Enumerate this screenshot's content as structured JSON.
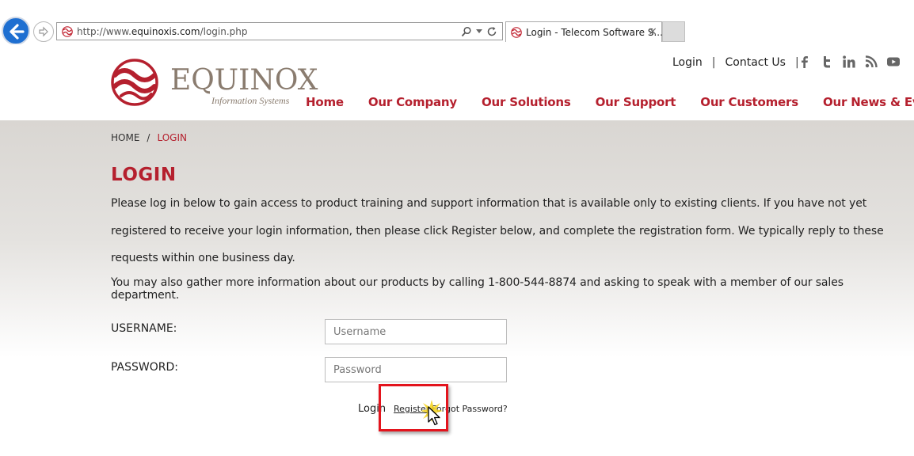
{
  "browser": {
    "url_prefix": "http://www.",
    "url_domain": "equinoxis.com",
    "url_path": "/login.php",
    "tab_title": "Login - Telecom Software S...",
    "tab_close": "×"
  },
  "header": {
    "brand": "EQUINOX",
    "tagline": "Information Systems",
    "top_links": {
      "login": "Login",
      "separator": "|",
      "contact": "Contact Us"
    },
    "nav": [
      "Home",
      "Our Company",
      "Our Solutions",
      "Our Support",
      "Our Customers",
      "Our News & Events"
    ],
    "social_icons": [
      "facebook-icon",
      "twitter-icon",
      "linkedin-icon",
      "rss-icon",
      "youtube-icon"
    ]
  },
  "breadcrumb": {
    "home": "HOME",
    "separator": "/",
    "current": "LOGIN"
  },
  "page": {
    "title": "LOGIN",
    "intro": "Please log in below to gain access to product training and support information that is available only to existing clients. If you have not yet registered to receive your login information, then please click Register below, and complete the registration form. We typically reply to these requests within one business day.",
    "intro2": "You may also gather more information about our products by calling 1-800-544-8874 and asking to speak with a member of our sales department."
  },
  "form": {
    "username_label": "USERNAME:",
    "username_placeholder": "Username",
    "username_value": "",
    "password_label": "PASSWORD:",
    "password_placeholder": "Password",
    "password_value": "",
    "login_label": "Login",
    "register_label": "Register",
    "forgot_label": "Forgot Password?"
  },
  "colors": {
    "brand_red": "#b5202e",
    "highlight": "#e3141d",
    "brand_gray": "#8a7c6f"
  }
}
